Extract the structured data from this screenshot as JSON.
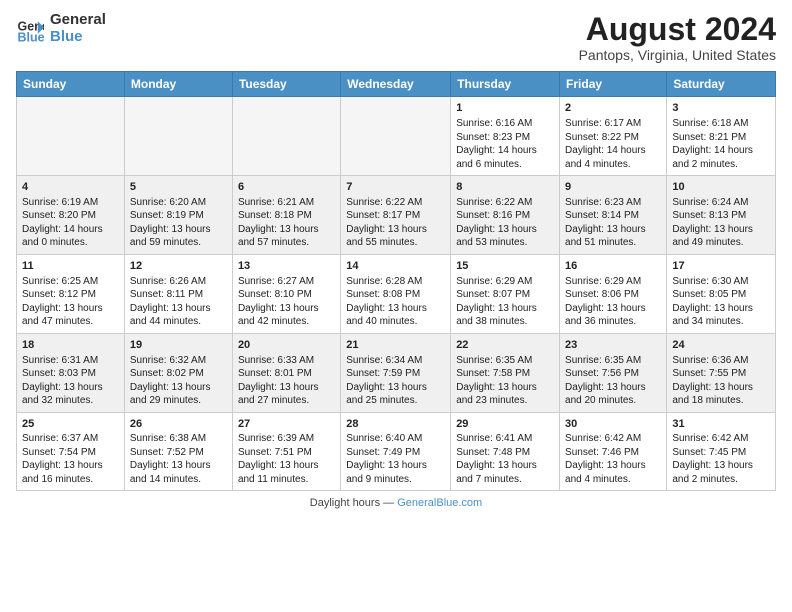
{
  "header": {
    "logo_line1": "General",
    "logo_line2": "Blue",
    "title": "August 2024",
    "subtitle": "Pantops, Virginia, United States"
  },
  "days_of_week": [
    "Sunday",
    "Monday",
    "Tuesday",
    "Wednesday",
    "Thursday",
    "Friday",
    "Saturday"
  ],
  "weeks": [
    [
      {
        "day": "",
        "empty": true
      },
      {
        "day": "",
        "empty": true
      },
      {
        "day": "",
        "empty": true
      },
      {
        "day": "",
        "empty": true
      },
      {
        "day": "1",
        "line1": "Sunrise: 6:16 AM",
        "line2": "Sunset: 8:23 PM",
        "line3": "Daylight: 14 hours",
        "line4": "and 6 minutes."
      },
      {
        "day": "2",
        "line1": "Sunrise: 6:17 AM",
        "line2": "Sunset: 8:22 PM",
        "line3": "Daylight: 14 hours",
        "line4": "and 4 minutes."
      },
      {
        "day": "3",
        "line1": "Sunrise: 6:18 AM",
        "line2": "Sunset: 8:21 PM",
        "line3": "Daylight: 14 hours",
        "line4": "and 2 minutes."
      }
    ],
    [
      {
        "day": "4",
        "line1": "Sunrise: 6:19 AM",
        "line2": "Sunset: 8:20 PM",
        "line3": "Daylight: 14 hours",
        "line4": "and 0 minutes."
      },
      {
        "day": "5",
        "line1": "Sunrise: 6:20 AM",
        "line2": "Sunset: 8:19 PM",
        "line3": "Daylight: 13 hours",
        "line4": "and 59 minutes."
      },
      {
        "day": "6",
        "line1": "Sunrise: 6:21 AM",
        "line2": "Sunset: 8:18 PM",
        "line3": "Daylight: 13 hours",
        "line4": "and 57 minutes."
      },
      {
        "day": "7",
        "line1": "Sunrise: 6:22 AM",
        "line2": "Sunset: 8:17 PM",
        "line3": "Daylight: 13 hours",
        "line4": "and 55 minutes."
      },
      {
        "day": "8",
        "line1": "Sunrise: 6:22 AM",
        "line2": "Sunset: 8:16 PM",
        "line3": "Daylight: 13 hours",
        "line4": "and 53 minutes."
      },
      {
        "day": "9",
        "line1": "Sunrise: 6:23 AM",
        "line2": "Sunset: 8:14 PM",
        "line3": "Daylight: 13 hours",
        "line4": "and 51 minutes."
      },
      {
        "day": "10",
        "line1": "Sunrise: 6:24 AM",
        "line2": "Sunset: 8:13 PM",
        "line3": "Daylight: 13 hours",
        "line4": "and 49 minutes."
      }
    ],
    [
      {
        "day": "11",
        "line1": "Sunrise: 6:25 AM",
        "line2": "Sunset: 8:12 PM",
        "line3": "Daylight: 13 hours",
        "line4": "and 47 minutes."
      },
      {
        "day": "12",
        "line1": "Sunrise: 6:26 AM",
        "line2": "Sunset: 8:11 PM",
        "line3": "Daylight: 13 hours",
        "line4": "and 44 minutes."
      },
      {
        "day": "13",
        "line1": "Sunrise: 6:27 AM",
        "line2": "Sunset: 8:10 PM",
        "line3": "Daylight: 13 hours",
        "line4": "and 42 minutes."
      },
      {
        "day": "14",
        "line1": "Sunrise: 6:28 AM",
        "line2": "Sunset: 8:08 PM",
        "line3": "Daylight: 13 hours",
        "line4": "and 40 minutes."
      },
      {
        "day": "15",
        "line1": "Sunrise: 6:29 AM",
        "line2": "Sunset: 8:07 PM",
        "line3": "Daylight: 13 hours",
        "line4": "and 38 minutes."
      },
      {
        "day": "16",
        "line1": "Sunrise: 6:29 AM",
        "line2": "Sunset: 8:06 PM",
        "line3": "Daylight: 13 hours",
        "line4": "and 36 minutes."
      },
      {
        "day": "17",
        "line1": "Sunrise: 6:30 AM",
        "line2": "Sunset: 8:05 PM",
        "line3": "Daylight: 13 hours",
        "line4": "and 34 minutes."
      }
    ],
    [
      {
        "day": "18",
        "line1": "Sunrise: 6:31 AM",
        "line2": "Sunset: 8:03 PM",
        "line3": "Daylight: 13 hours",
        "line4": "and 32 minutes."
      },
      {
        "day": "19",
        "line1": "Sunrise: 6:32 AM",
        "line2": "Sunset: 8:02 PM",
        "line3": "Daylight: 13 hours",
        "line4": "and 29 minutes."
      },
      {
        "day": "20",
        "line1": "Sunrise: 6:33 AM",
        "line2": "Sunset: 8:01 PM",
        "line3": "Daylight: 13 hours",
        "line4": "and 27 minutes."
      },
      {
        "day": "21",
        "line1": "Sunrise: 6:34 AM",
        "line2": "Sunset: 7:59 PM",
        "line3": "Daylight: 13 hours",
        "line4": "and 25 minutes."
      },
      {
        "day": "22",
        "line1": "Sunrise: 6:35 AM",
        "line2": "Sunset: 7:58 PM",
        "line3": "Daylight: 13 hours",
        "line4": "and 23 minutes."
      },
      {
        "day": "23",
        "line1": "Sunrise: 6:35 AM",
        "line2": "Sunset: 7:56 PM",
        "line3": "Daylight: 13 hours",
        "line4": "and 20 minutes."
      },
      {
        "day": "24",
        "line1": "Sunrise: 6:36 AM",
        "line2": "Sunset: 7:55 PM",
        "line3": "Daylight: 13 hours",
        "line4": "and 18 minutes."
      }
    ],
    [
      {
        "day": "25",
        "line1": "Sunrise: 6:37 AM",
        "line2": "Sunset: 7:54 PM",
        "line3": "Daylight: 13 hours",
        "line4": "and 16 minutes."
      },
      {
        "day": "26",
        "line1": "Sunrise: 6:38 AM",
        "line2": "Sunset: 7:52 PM",
        "line3": "Daylight: 13 hours",
        "line4": "and 14 minutes."
      },
      {
        "day": "27",
        "line1": "Sunrise: 6:39 AM",
        "line2": "Sunset: 7:51 PM",
        "line3": "Daylight: 13 hours",
        "line4": "and 11 minutes."
      },
      {
        "day": "28",
        "line1": "Sunrise: 6:40 AM",
        "line2": "Sunset: 7:49 PM",
        "line3": "Daylight: 13 hours",
        "line4": "and 9 minutes."
      },
      {
        "day": "29",
        "line1": "Sunrise: 6:41 AM",
        "line2": "Sunset: 7:48 PM",
        "line3": "Daylight: 13 hours",
        "line4": "and 7 minutes."
      },
      {
        "day": "30",
        "line1": "Sunrise: 6:42 AM",
        "line2": "Sunset: 7:46 PM",
        "line3": "Daylight: 13 hours",
        "line4": "and 4 minutes."
      },
      {
        "day": "31",
        "line1": "Sunrise: 6:42 AM",
        "line2": "Sunset: 7:45 PM",
        "line3": "Daylight: 13 hours",
        "line4": "and 2 minutes."
      }
    ]
  ],
  "footer": {
    "text": "Daylight hours",
    "source": "GeneralBlue.com"
  }
}
